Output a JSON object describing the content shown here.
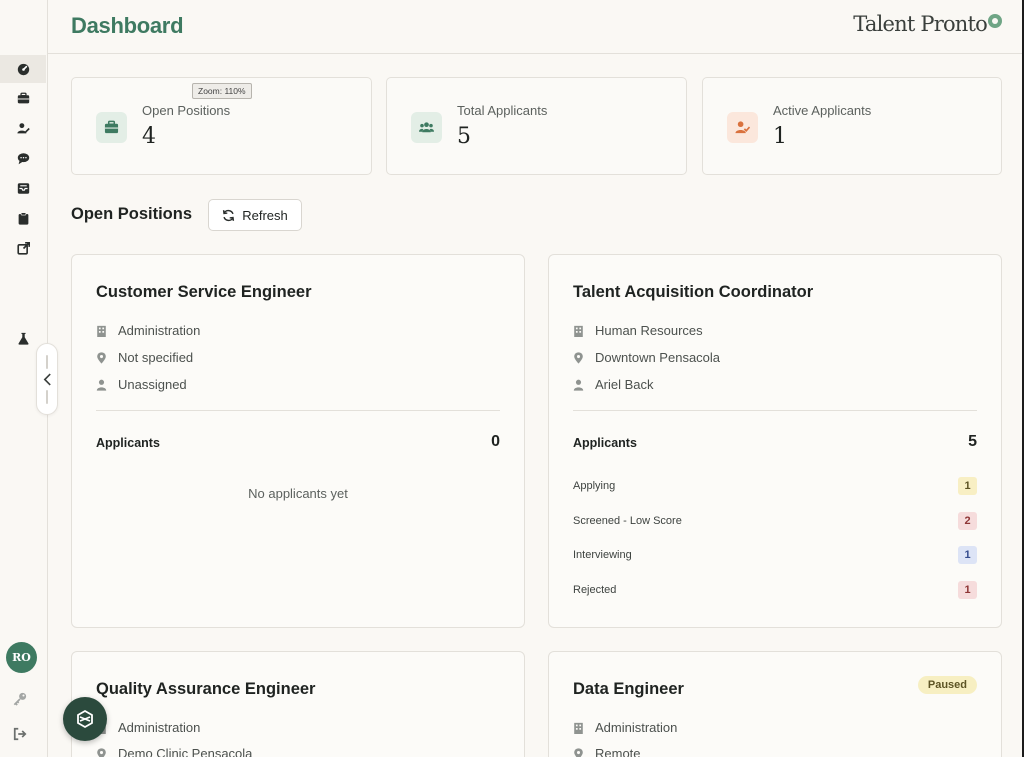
{
  "header": {
    "title": "Dashboard",
    "logo_text": "Talent Pronto"
  },
  "sidebar": {
    "items": [
      {
        "icon": "dashboard-gauge-icon",
        "active": true
      },
      {
        "icon": "briefcase-icon"
      },
      {
        "icon": "user-edit-icon"
      },
      {
        "icon": "chat-bubble-icon"
      },
      {
        "icon": "inbox-icon"
      },
      {
        "icon": "clipboard-icon"
      },
      {
        "icon": "external-link-icon"
      },
      {
        "icon": "flask-icon"
      }
    ],
    "avatar_initials": "RO",
    "bottom_icons": [
      "key-icon",
      "logout-icon"
    ]
  },
  "tooltip": "Zoom: 110%",
  "stats": [
    {
      "label": "Open Positions",
      "value": "4",
      "icon": "briefcase-icon",
      "color": "#3e7a61",
      "bg": "#e3eee6"
    },
    {
      "label": "Total Applicants",
      "value": "5",
      "icon": "users-icon",
      "color": "#3e7a61",
      "bg": "#e3eee6"
    },
    {
      "label": "Active Applicants",
      "value": "1",
      "icon": "user-check-icon",
      "color": "#d9713d",
      "bg": "#fbe7dc"
    }
  ],
  "section": {
    "title": "Open Positions",
    "refresh_label": "Refresh"
  },
  "positions": [
    {
      "title": "Customer Service Engineer",
      "department": "Administration",
      "location": "Not specified",
      "assignee": "Unassigned",
      "applicants_label": "Applicants",
      "applicants_count": "0",
      "empty_text": "No applicants yet"
    },
    {
      "title": "Talent Acquisition Coordinator",
      "department": "Human Resources",
      "location": "Downtown Pensacola",
      "assignee": "Ariel Back",
      "applicants_label": "Applicants",
      "applicants_count": "5",
      "stages": [
        {
          "label": "Applying",
          "count": "1",
          "bg": "#f8efc4",
          "fg": "#5d5424"
        },
        {
          "label": "Screened - Low Score",
          "count": "2",
          "bg": "#f6dcdc",
          "fg": "#8e3535"
        },
        {
          "label": "Interviewing",
          "count": "1",
          "bg": "#dde4f6",
          "fg": "#364d8e"
        },
        {
          "label": "Rejected",
          "count": "1",
          "bg": "#f6dcdc",
          "fg": "#8e3535"
        }
      ]
    },
    {
      "title": "Quality Assurance Engineer",
      "department": "Administration",
      "location": "Demo Clinic Pensacola"
    },
    {
      "title": "Data Engineer",
      "status": "Paused",
      "department": "Administration",
      "location": "Remote"
    }
  ],
  "colors": {
    "brand": "#3e7a61",
    "background": "#faf8f4",
    "border": "#e3e0da",
    "fab": "#2b4a3d"
  }
}
